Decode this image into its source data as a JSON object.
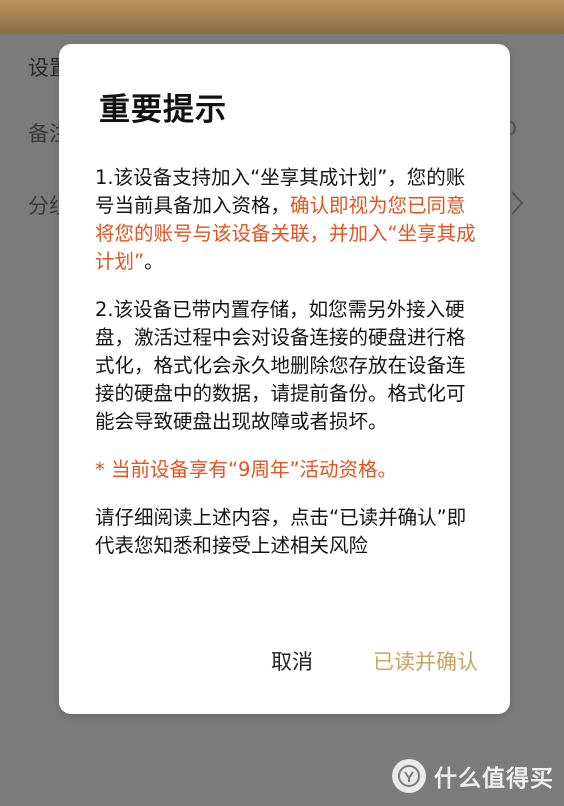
{
  "background": {
    "section_label": "设置",
    "rows": [
      {
        "label": "备注"
      },
      {
        "label": "分组"
      }
    ]
  },
  "dialog": {
    "title": "重要提示",
    "para1": {
      "normal_1": "1.该设备支持加入“坐享其成计划”，您的账号当前具备加入资格，",
      "highlight": "确认即视为您已同意将您的账号与该设备关联，并加入“坐享其成计划”",
      "normal_2": "。"
    },
    "para2": "2.该设备已带内置存储，如您需另外接入硬盘，激活过程中会对设备连接的硬盘进行格式化，格式化会永久地删除您存放在设备连接的硬盘中的数据，请提前备份。格式化可能会导致硬盘出现故障或者损坏。",
    "note": "* 当前设备享有“9周年”活动资格。",
    "para3": "请仔细阅读上述内容，点击“已读并确认”即代表您知悉和接受上述相关风险",
    "cancel_label": "取消",
    "confirm_label": "已读并确认"
  },
  "watermark": {
    "logo_symbol": "值",
    "text": "什么值得买"
  },
  "colors": {
    "highlight": "#e5521f",
    "confirm": "#c9a462",
    "overlay": "#7b7b7b"
  }
}
